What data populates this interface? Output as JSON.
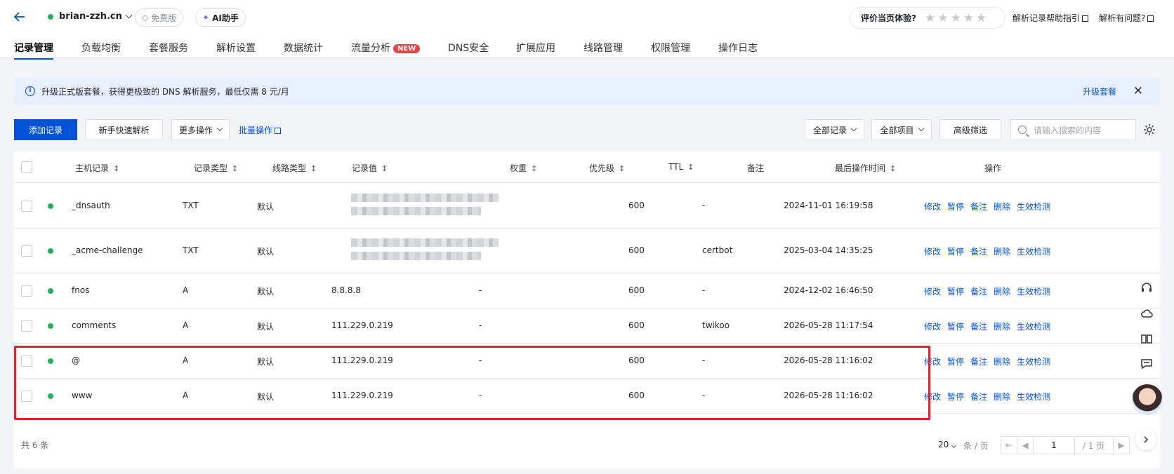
{
  "header": {
    "domain": "brian-zzh.cn",
    "plan_badge": "免费版",
    "ai_label": "AI助手",
    "rate_label": "评价当页体验?",
    "rate_stars": "★★★★★",
    "help_link": "解析记录帮助指引",
    "issue_link": "解析有问题?"
  },
  "tabs": [
    {
      "label": "记录管理"
    },
    {
      "label": "负载均衡"
    },
    {
      "label": "套餐服务"
    },
    {
      "label": "解析设置"
    },
    {
      "label": "数据统计"
    },
    {
      "label": "流量分析",
      "badge": "NEW"
    },
    {
      "label": "DNS安全"
    },
    {
      "label": "扩展应用"
    },
    {
      "label": "线路管理"
    },
    {
      "label": "权限管理"
    },
    {
      "label": "操作日志"
    }
  ],
  "banner": {
    "message": "升级正式版套餐，获得更极致的 DNS 解析服务，最低仅需 8 元/月",
    "upgrade": "升级套餐"
  },
  "toolbar": {
    "add": "添加记录",
    "quick": "新手快速解析",
    "more": "更多操作",
    "batch": "批量操作",
    "filter_all_records": "全部记录",
    "filter_all_items": "全部项目",
    "advanced": "高级筛选",
    "search_placeholder": "请输入搜索的内容"
  },
  "columns": {
    "host": "主机记录",
    "type": "记录类型",
    "line": "线路类型",
    "value": "记录值",
    "weight": "权重",
    "priority": "优先级",
    "ttl": "TTL",
    "remark": "备注",
    "time": "最后操作时间",
    "ops": "操作"
  },
  "rows": [
    {
      "host": "_dnsauth",
      "type": "TXT",
      "line": "默认",
      "value": "",
      "weight": "",
      "priority": "",
      "ttl": "600",
      "remark": "-",
      "time": "2024-11-01 16:19:58"
    },
    {
      "host": "_acme-challenge",
      "type": "TXT",
      "line": "默认",
      "value": "",
      "weight": "",
      "priority": "",
      "ttl": "600",
      "remark": "certbot",
      "time": "2025-03-04 14:35:25"
    },
    {
      "host": "fnos",
      "type": "A",
      "line": "默认",
      "value": "8.8.8.8",
      "weight": "-",
      "priority": "",
      "ttl": "600",
      "remark": "-",
      "time": "2024-12-02 16:46:50"
    },
    {
      "host": "comments",
      "type": "A",
      "line": "默认",
      "value": "111.229.0.219",
      "weight": "-",
      "priority": "",
      "ttl": "600",
      "remark": "twikoo",
      "time": "2026-05-28 11:17:54"
    },
    {
      "host": "@",
      "type": "A",
      "line": "默认",
      "value": "111.229.0.219",
      "weight": "-",
      "priority": "",
      "ttl": "600",
      "remark": "-",
      "time": "2026-05-28 11:16:02"
    },
    {
      "host": "www",
      "type": "A",
      "line": "默认",
      "value": "111.229.0.219",
      "weight": "-",
      "priority": "",
      "ttl": "600",
      "remark": "-",
      "time": "2026-05-28 11:16:02"
    }
  ],
  "ops": [
    "修改",
    "暂停",
    "备注",
    "删除",
    "生效检测"
  ],
  "footer": {
    "total": "共 6 条",
    "page_size": "20",
    "per_page": "条 / 页",
    "page": "1",
    "page_total": "/ 1 页"
  },
  "colors": {
    "primary": "#0052d9",
    "enabled_dot": "#1fb35a",
    "highlight": "#e8202a"
  },
  "icons": [
    "back-arrow-icon",
    "diamond-icon",
    "sparkle-icon",
    "external-link-icon",
    "info-icon",
    "close-icon",
    "search-icon",
    "settings-gear-icon",
    "headset-icon",
    "cloud-icon",
    "book-icon",
    "feedback-icon"
  ]
}
